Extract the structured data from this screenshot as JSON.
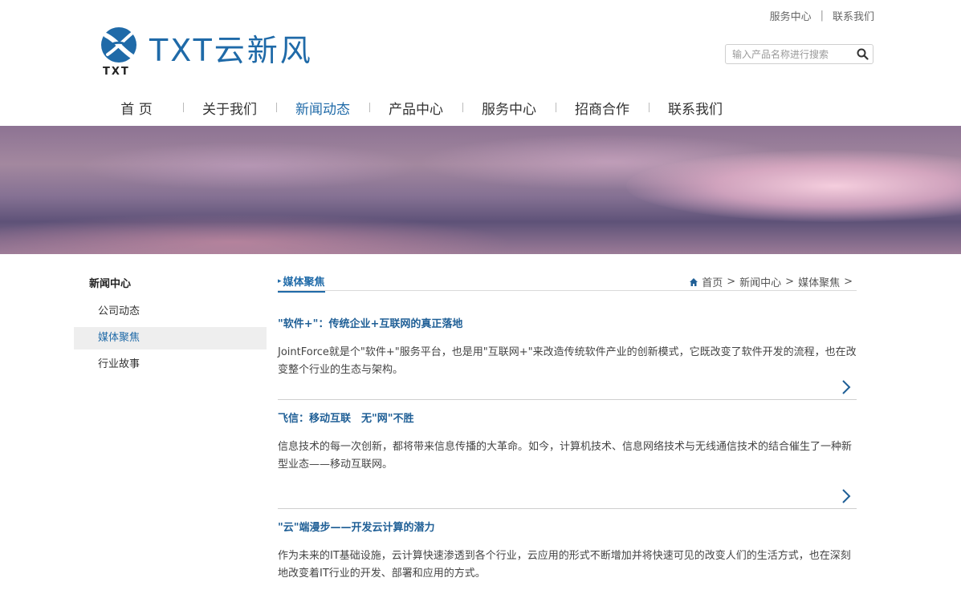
{
  "top_links": {
    "service": "服务中心",
    "separator": "|",
    "contact": "联系我们"
  },
  "logo": {
    "mark_text": "TXT",
    "brand": "TXT云新风",
    "colors": {
      "brand": "#1f6aa8"
    }
  },
  "search": {
    "placeholder": "输入产品名称进行搜索",
    "icon": "search-icon"
  },
  "nav": {
    "items": [
      {
        "label": "首 页"
      },
      {
        "label": "关于我们"
      },
      {
        "label": "新闻动态"
      },
      {
        "label": "产品中心"
      },
      {
        "label": "服务中心"
      },
      {
        "label": "招商合作"
      },
      {
        "label": "联系我们"
      }
    ],
    "active": "新闻动态"
  },
  "sidebar": {
    "title": "新闻中心",
    "items": [
      {
        "label": "公司动态"
      },
      {
        "label": "媒体聚焦"
      },
      {
        "label": "行业故事"
      }
    ],
    "active": "媒体聚焦"
  },
  "main": {
    "category": "媒体聚焦",
    "breadcrumb": {
      "home": "首页",
      "sep": ">",
      "level1": "新闻中心",
      "level2": "媒体聚焦"
    },
    "articles": [
      {
        "title": "\"软件+\"：传统企业+互联网的真正落地",
        "desc": "JointForce就是个\"软件+\"服务平台，也是用\"互联网+\"来改造传统软件产业的创新模式，它既改变了软件开发的流程，也在改变整个行业的生态与架构。"
      },
      {
        "title": "飞信：移动互联　无\"网\"不胜",
        "desc": "信息技术的每一次创新，都将带来信息传播的大革命。如今，计算机技术、信息网络技术与无线通信技术的结合催生了一种新型业态——移动互联网。"
      },
      {
        "title": "\"云\"端漫步——开发云计算的潜力",
        "desc": "作为未来的IT基础设施，云计算快速渗透到各个行业，云应用的形式不断增加并将快速可见的改变人们的生活方式，也在深刻地改变着IT行业的开发、部署和应用的方式。"
      }
    ]
  }
}
